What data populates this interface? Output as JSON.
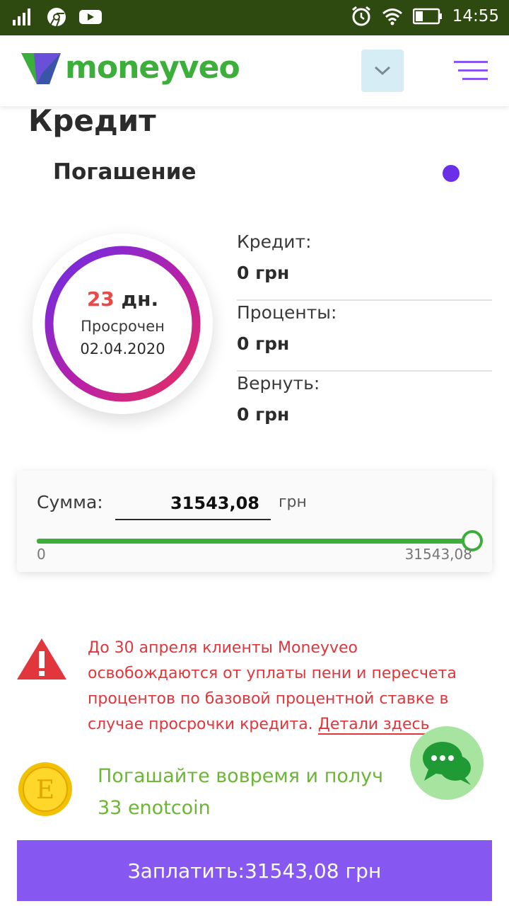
{
  "status_bar": {
    "time": "14:55"
  },
  "brand": {
    "name": "moneyveo",
    "green": "#3cae3a",
    "purple": "#8757f2"
  },
  "page": {
    "title": "Кредит",
    "section_title": "Погашение"
  },
  "circle": {
    "days_number": "23",
    "days_unit": "дн.",
    "status": "Просрочен",
    "date": "02.04.2020"
  },
  "summary": {
    "rows": [
      {
        "label": "Кредит:",
        "value": "0 грн"
      },
      {
        "label": "Проценты:",
        "value": "0 грн"
      },
      {
        "label": "Вернуть:",
        "value": "0 грн"
      }
    ]
  },
  "amount": {
    "label": "Сумма:",
    "value": "31543,08",
    "unit": "грн",
    "slider_min": "0",
    "slider_max": "31543,08",
    "slider_fraction": 1.0
  },
  "warning": {
    "text": "До 30 апреля клиенты Moneyveo освобождаются от уплаты пени и пересчета процентов по базовой процентной ставке в случае просрочки кредита.",
    "link": "Детали здесь"
  },
  "promo": {
    "line1": "Погашайте вовремя и получ",
    "line2": "33 enotcoin",
    "coin_letter": "E"
  },
  "pay_button": {
    "label": "Заплатить:31543,08 грн"
  }
}
